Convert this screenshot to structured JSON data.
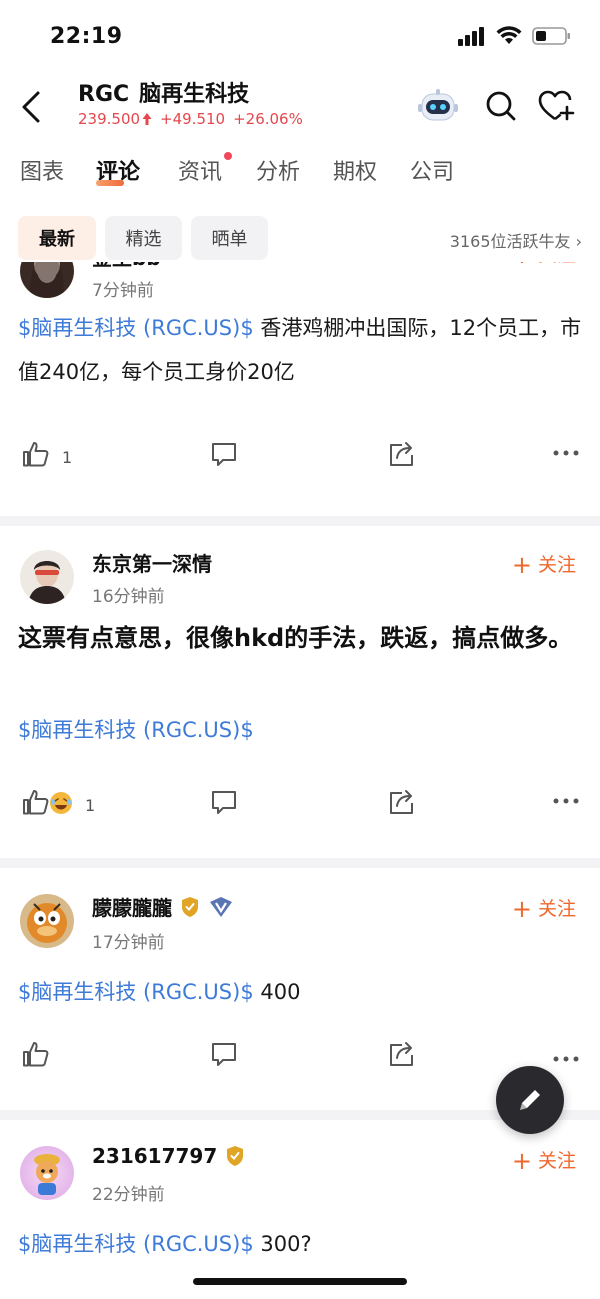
{
  "status": {
    "time": "22:19"
  },
  "header": {
    "ticker": "RGC",
    "name": "脑再生科技",
    "price": "239.500",
    "change": "+49.510",
    "change_pct": "+26.06%"
  },
  "tabs": [
    "图表",
    "评论",
    "资讯",
    "分析",
    "期权",
    "公司"
  ],
  "filters": {
    "items": [
      "最新",
      "精选",
      "晒单"
    ],
    "active_friends": "3165位活跃牛友 ›"
  },
  "posts": [
    {
      "author": "金王bb",
      "time": "7分钟前",
      "follow": "关注",
      "tag": "$脑再生科技 (RGC.US)$",
      "text": " 香港鸡棚冲出国际，12个员工，市值240亿，每个员工身价20亿",
      "likes": "1"
    },
    {
      "author": "东京第一深情",
      "time": "16分钟前",
      "follow": "关注",
      "headline": "这票有点意思，很像hkd的手法，跌返，搞点做多。",
      "tag": "$脑再生科技 (RGC.US)$",
      "likes": "1"
    },
    {
      "author": "朦朦朧朧",
      "time": "17分钟前",
      "follow": "关注",
      "tag": "$脑再生科技 (RGC.US)$",
      "text": " 400"
    },
    {
      "author": "231617797",
      "time": "22分钟前",
      "follow": "关注",
      "tag": "$脑再生科技 (RGC.US)$",
      "text": " 300?"
    }
  ],
  "colors": {
    "up": "#e4474d",
    "accent": "#f0672d",
    "link": "#3e7bd8"
  }
}
